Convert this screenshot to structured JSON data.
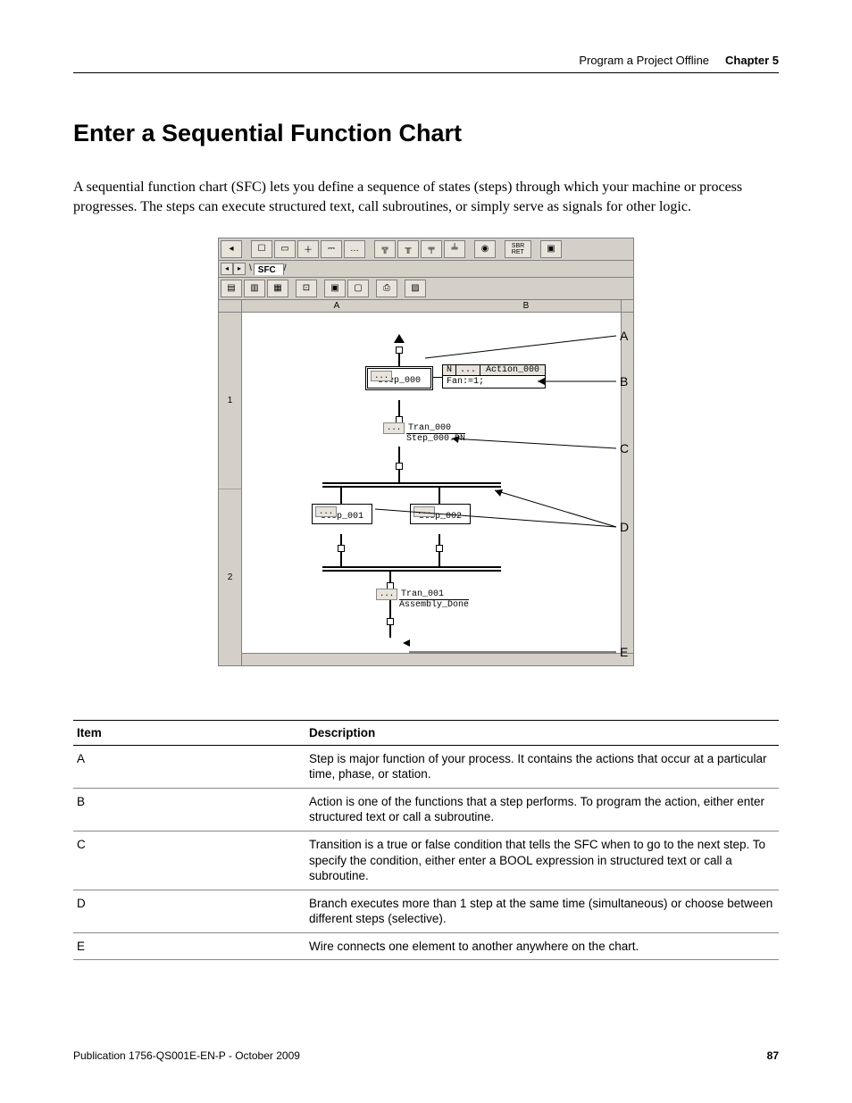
{
  "header": {
    "section": "Program a Project Offline",
    "chapter": "Chapter 5"
  },
  "title": "Enter a Sequential Function Chart",
  "intro": "A sequential function chart (SFC) lets you define a sequence of states (steps) through which your machine or process progresses. The steps can execute structured text, call subroutines, or simply serve as signals for other logic.",
  "editor": {
    "tab": "SFC",
    "col_a": "A",
    "col_b": "B",
    "row1": "1",
    "row2": "2",
    "step000": "Step_000",
    "step001": "Step_001",
    "step002": "Step_002",
    "action_q": "N",
    "action_dots": "...",
    "action_name": "Action_000",
    "action_body": "Fan:=1;",
    "tran000": "Tran_000",
    "tran000_cond": "Step_000.DN",
    "tran001": "Tran_001",
    "tran001_cond": "Assembly_Done",
    "dots": "..."
  },
  "callouts": {
    "A": "A",
    "B": "B",
    "C": "C",
    "D": "D",
    "E": "E"
  },
  "table": {
    "h_item": "Item",
    "h_desc": "Description",
    "rows": [
      {
        "item": "A",
        "desc": "Step is major function of your process. It contains the actions that occur at a particular time, phase, or station."
      },
      {
        "item": "B",
        "desc": "Action is one of the functions that a step performs. To program the action, either enter structured text or call a subroutine."
      },
      {
        "item": "C",
        "desc": "Transition is a true or false condition that tells the SFC when to go to the next step. To specify the condition, either enter a BOOL expression in structured text or call a subroutine."
      },
      {
        "item": "D",
        "desc": "Branch executes more than 1 step at the same time (simultaneous) or choose between different steps (selective)."
      },
      {
        "item": "E",
        "desc": "Wire connects one element to another anywhere on the chart."
      }
    ]
  },
  "footer": {
    "pub": "Publication 1756-QS001E-EN-P - October 2009",
    "page": "87"
  }
}
